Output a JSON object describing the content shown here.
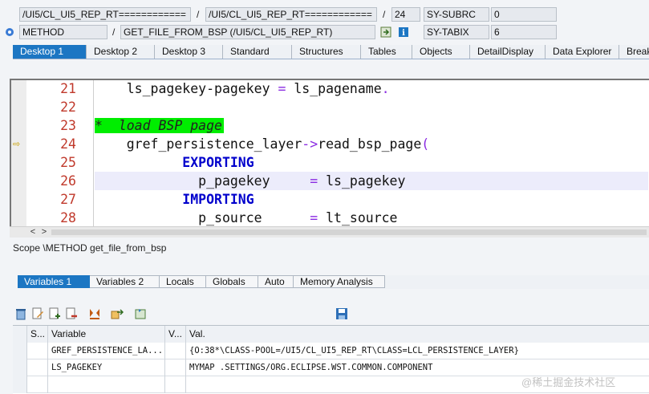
{
  "info": {
    "row1": {
      "program": "/UI5/CL_UI5_REP_RT============",
      "include": "/UI5/CL_UI5_REP_RT============",
      "sep": "/",
      "line": "24",
      "sysfield": "SY-SUBRC",
      "sysvalue": "0"
    },
    "row2": {
      "event_type": "METHOD",
      "event": "GET_FILE_FROM_BSP (/UI5/CL_UI5_REP_RT)",
      "sep": "/",
      "sysfield": "SY-TABIX",
      "sysvalue": "6"
    }
  },
  "desktop_tabs": [
    "Desktop 1",
    "Desktop 2",
    "Desktop 3",
    "Standard",
    "Structures",
    "Tables",
    "Objects",
    "DetailDisplay",
    "Data Explorer",
    "Break"
  ],
  "code": {
    "lines": [
      {
        "no": "21",
        "parts": [
          [
            "",
            "    ls_pagekey-pagekey "
          ],
          [
            "op",
            "="
          ],
          [
            "",
            " ls_pagename"
          ],
          [
            "op",
            "."
          ]
        ]
      },
      {
        "no": "22",
        "parts": []
      },
      {
        "no": "23",
        "parts": [
          [
            "cmt",
            "*  load BSP page"
          ]
        ]
      },
      {
        "no": "24",
        "parts": [
          [
            "",
            "    gref_persistence_layer"
          ],
          [
            "op",
            "->"
          ],
          [
            "",
            "read_bsp_page"
          ],
          [
            "op",
            "("
          ]
        ]
      },
      {
        "no": "25",
        "parts": [
          [
            "kw",
            "           EXPORTING"
          ]
        ]
      },
      {
        "no": "26",
        "parts": [
          [
            "",
            "             p_pagekey     "
          ],
          [
            "op",
            "="
          ],
          [
            "",
            " ls_pagekey"
          ]
        ]
      },
      {
        "no": "27",
        "parts": [
          [
            "kw",
            "           IMPORTING"
          ]
        ]
      },
      {
        "no": "28",
        "parts": [
          [
            "",
            "             p_source      "
          ],
          [
            "op",
            "="
          ],
          [
            "",
            " lt_source"
          ]
        ]
      }
    ]
  },
  "scope_text": "Scope \\METHOD get_file_from_bsp",
  "variable_tabs": [
    "Variables 1",
    "Variables 2",
    "Locals",
    "Globals",
    "Auto",
    "Memory Analysis"
  ],
  "table": {
    "headers": {
      "s": "S...",
      "variable": "Variable",
      "v": "V...",
      "val": "Val."
    },
    "rows": [
      {
        "variable": "GREF_PERSISTENCE_LA...",
        "value": "{O:38*\\CLASS-POOL=/UI5/CL_UI5_REP_RT\\CLASS=LCL_PERSISTENCE_LAYER}"
      },
      {
        "variable": "LS_PAGEKEY",
        "value": "MYMAP                                 .SETTINGS/ORG.ECLIPSE.WST.COMMON.COMPONENT"
      }
    ]
  },
  "watermark": "@稀土掘金技术社区",
  "icons": [
    "event-icon",
    "enter-icon",
    "info-icon",
    "delete-icon",
    "edit-icon",
    "insert-icon",
    "delete-row-icon",
    "breakpoint-icon",
    "export-icon",
    "refresh-icon",
    "save-icon"
  ]
}
